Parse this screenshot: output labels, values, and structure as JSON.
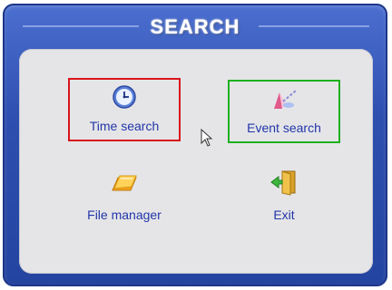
{
  "window": {
    "title": "SEARCH"
  },
  "menu": {
    "items": [
      {
        "label": "Time search",
        "icon": "clock-icon",
        "highlight": "#d9141c"
      },
      {
        "label": "Event search",
        "icon": "event-search-icon",
        "highlight": "#1eb01e"
      },
      {
        "label": "File manager",
        "icon": "folder-icon"
      },
      {
        "label": "Exit",
        "icon": "exit-door-icon"
      }
    ]
  },
  "colors": {
    "frame": "#2f4fb0",
    "panel": "#e5e5e8",
    "label_text": "#2236a8"
  }
}
